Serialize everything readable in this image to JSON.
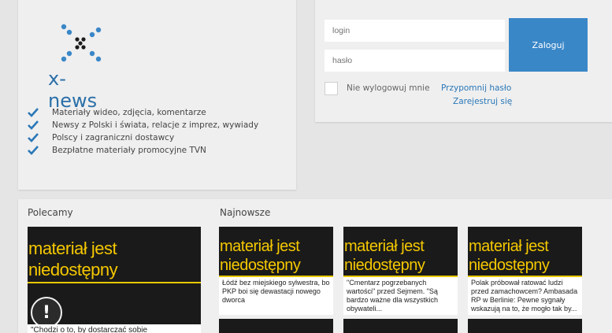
{
  "brand": {
    "logo_text": "x-news",
    "features": [
      "Materiały wideo, zdjęcia, komentarze",
      "Newsy z Polski i świata, relacje z imprez, wywiady",
      "Polscy i zagraniczni dostawcy",
      "Bezpłatne materiały promocyjne TVN"
    ],
    "accent_color": "#2a6fa8",
    "check_color": "#2a77b8"
  },
  "login": {
    "login_placeholder": "login",
    "password_placeholder": "hasło",
    "submit_label": "Zaloguj",
    "remember_label": "Nie wylogowuj mnie",
    "forgot_link": "Przypomnij hasło",
    "register_link": "Zarejestruj się",
    "button_color": "#3a87c8"
  },
  "content": {
    "recommended_title": "Polecamy",
    "newest_title": "Najnowsze",
    "unavailable_text": "materiał jest niedostępny",
    "featured": {
      "caption": "\"Chodzi o to, by dostarczać sobie",
      "alert_symbol": "!"
    },
    "news": [
      {
        "caption": "Łódź bez miejskiego sylwestra, bo PKP boi się dewastacji nowego dworca"
      },
      {
        "caption": "\"Cmentarz pogrzebanych wartości\" przed Sejmem. \"Są bardzo ważne dla wszystkich obywateli..."
      },
      {
        "caption": "Polak próbował ratować ludzi przed zamachowcem? Ambasada RP w Berlinie: Pewne sygnały wskazują na to, że mogło tak by..."
      }
    ]
  }
}
